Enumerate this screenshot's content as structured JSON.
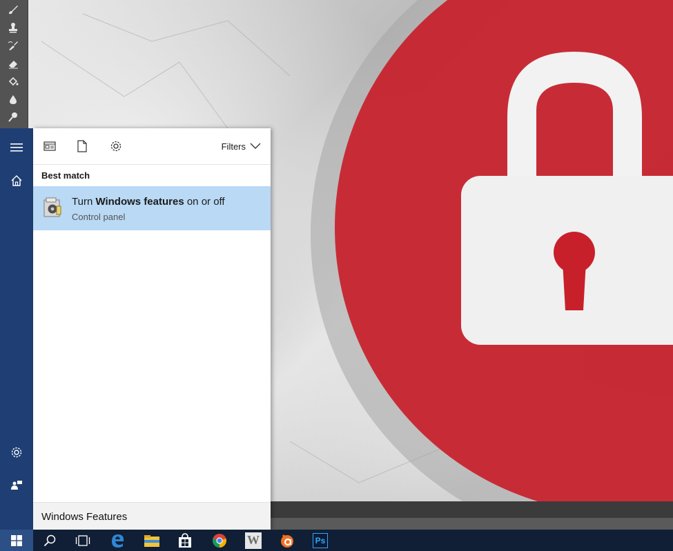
{
  "start_menu": {
    "header": {
      "filters_label": "Filters",
      "icons": [
        "apps-icon",
        "documents-icon",
        "settings-icon"
      ]
    },
    "section_label": "Best match",
    "result": {
      "title_prefix": "Turn ",
      "title_bold": "Windows features",
      "title_suffix": " on or off",
      "subtitle": "Control panel",
      "icon": "windows-features-icon"
    },
    "search": {
      "value": "Windows Features",
      "placeholder": ""
    },
    "rail_icons": [
      "hamburger-icon",
      "home-icon",
      "settings-icon",
      "feedback-icon"
    ]
  },
  "taskbar": {
    "items": [
      "start-icon",
      "search-icon",
      "task-view-icon",
      "edge-icon",
      "file-explorer-icon",
      "store-icon",
      "chrome-icon",
      "word-icon",
      "avast-icon",
      "photoshop-icon"
    ],
    "photoshop_label": "Ps",
    "word_label": "W"
  },
  "colors": {
    "start_rail": "#1f3f74",
    "selection": "#b9d9f5",
    "taskbar": "#101f36",
    "lock_red": "#c8202a"
  }
}
